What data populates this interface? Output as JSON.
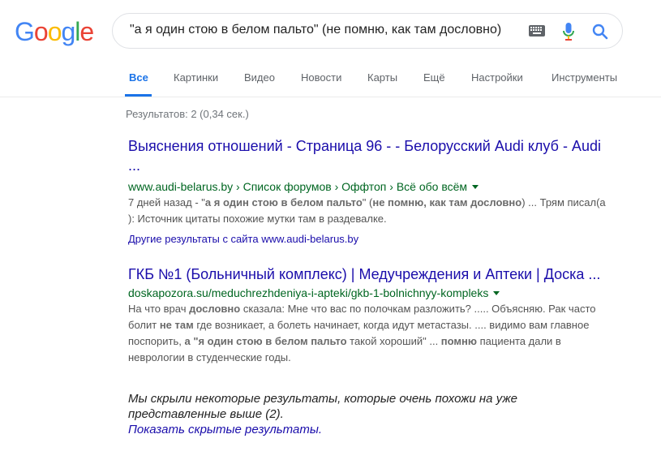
{
  "logo": {
    "letters": [
      "G",
      "o",
      "o",
      "g",
      "l",
      "e"
    ],
    "colors": [
      "#4285f4",
      "#ea4335",
      "#fbbc05",
      "#4285f4",
      "#34a853",
      "#ea4335"
    ]
  },
  "search": {
    "query": "\"а я один стою в белом пальто\" (не помню, как там дословно)",
    "icons": [
      "keyboard-icon",
      "microphone-icon",
      "search-icon"
    ]
  },
  "tabs": [
    {
      "label": "Все",
      "active": true
    },
    {
      "label": "Картинки"
    },
    {
      "label": "Видео"
    },
    {
      "label": "Новости"
    },
    {
      "label": "Карты"
    },
    {
      "label": "Ещё"
    },
    {
      "label": "Настройки"
    },
    {
      "label": "Инструменты"
    }
  ],
  "stats": "Результатов: 2 (0,34 сек.)",
  "results": [
    {
      "title_line1": "Выяснения отношений - Страница 96 - - Белорусский Audi клуб - Audi",
      "title_line2": "...",
      "url": "www.audi-belarus.by › Список форумов › Оффтоп › Всё обо всём",
      "snippet": {
        "s1": "7 дней назад - \"",
        "b1": "а я один стою в белом пальто",
        "s2": "\" (",
        "b2": "не помню, как там дословно",
        "s3": ") ... Трям писал(а",
        "s4": "): Источник цитаты похожие мутки там в раздевалке."
      },
      "more": "Другие результаты с сайта www.audi-belarus.by"
    },
    {
      "title": "ГКБ №1 (Больничный комплекс) | Медучреждения и Аптеки | Доска ...",
      "url": "doskapozora.su/meduchrezhdeniya-i-apteki/gkb-1-bolnichnyy-kompleks",
      "snippet": {
        "s1": "На что врач ",
        "b1": "дословно",
        "s2": " сказала: Мне что вас по полочкам разложить? ..... Объясняю. Рак часто",
        "s3": "болит ",
        "b2": "не там",
        "s4": " где возникает, а болеть начинает, когда идут метастазы. .... видимо вам главное",
        "s5": "поспорить, ",
        "b3": "а \"я один стою в белом пальто",
        "s6": " такой хороший\" ... ",
        "b4": "помню",
        "s7": " пациента дали в",
        "s8": "неврологии в студенческие годы."
      }
    }
  ],
  "hidden": {
    "line1": "Мы скрыли некоторые результаты, которые очень похожи на уже",
    "line2": "представленные выше (2).",
    "link": "Показать скрытые результаты."
  }
}
